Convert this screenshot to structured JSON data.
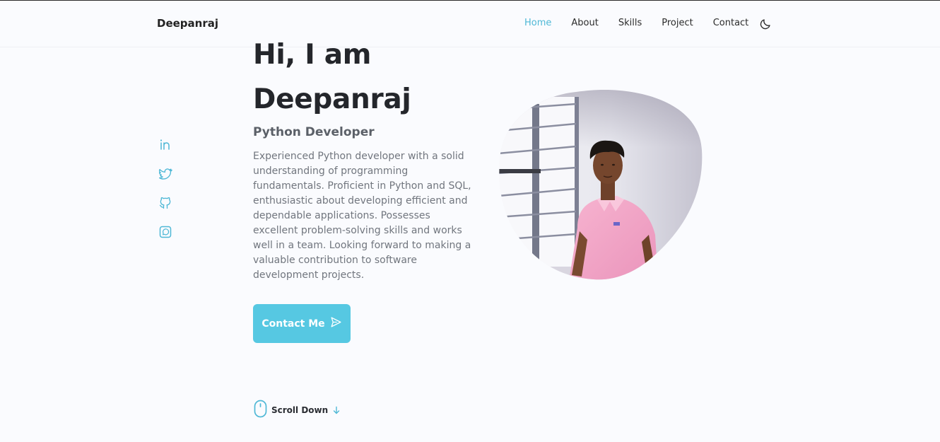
{
  "header": {
    "logo": "Deepanraj",
    "nav": [
      {
        "label": "Home",
        "active": true
      },
      {
        "label": "About",
        "active": false
      },
      {
        "label": "Skills",
        "active": false
      },
      {
        "label": "Project",
        "active": false
      },
      {
        "label": "Contact",
        "active": false
      }
    ],
    "theme_icon": "moon-icon"
  },
  "social": [
    "linkedin-icon",
    "twitter-icon",
    "github-icon",
    "whatsapp-icon"
  ],
  "hero": {
    "greeting": "Hi, I am",
    "name": "Deepanraj",
    "subtitle": "Python Developer",
    "description": "Experienced Python developer with a solid understanding of programming fundamentals. Proficient in Python and SQL, enthusiastic about developing efficient and dependable applications. Possesses excellent problem-solving skills and works well in a team. Looking forward to making a valuable contribution to software development projects.",
    "contact_button": "Contact Me",
    "scroll_down": "Scroll Down"
  },
  "colors": {
    "accent": "#56c8e2",
    "accent_text": "#4fb8d6",
    "background": "#fafbfe"
  }
}
